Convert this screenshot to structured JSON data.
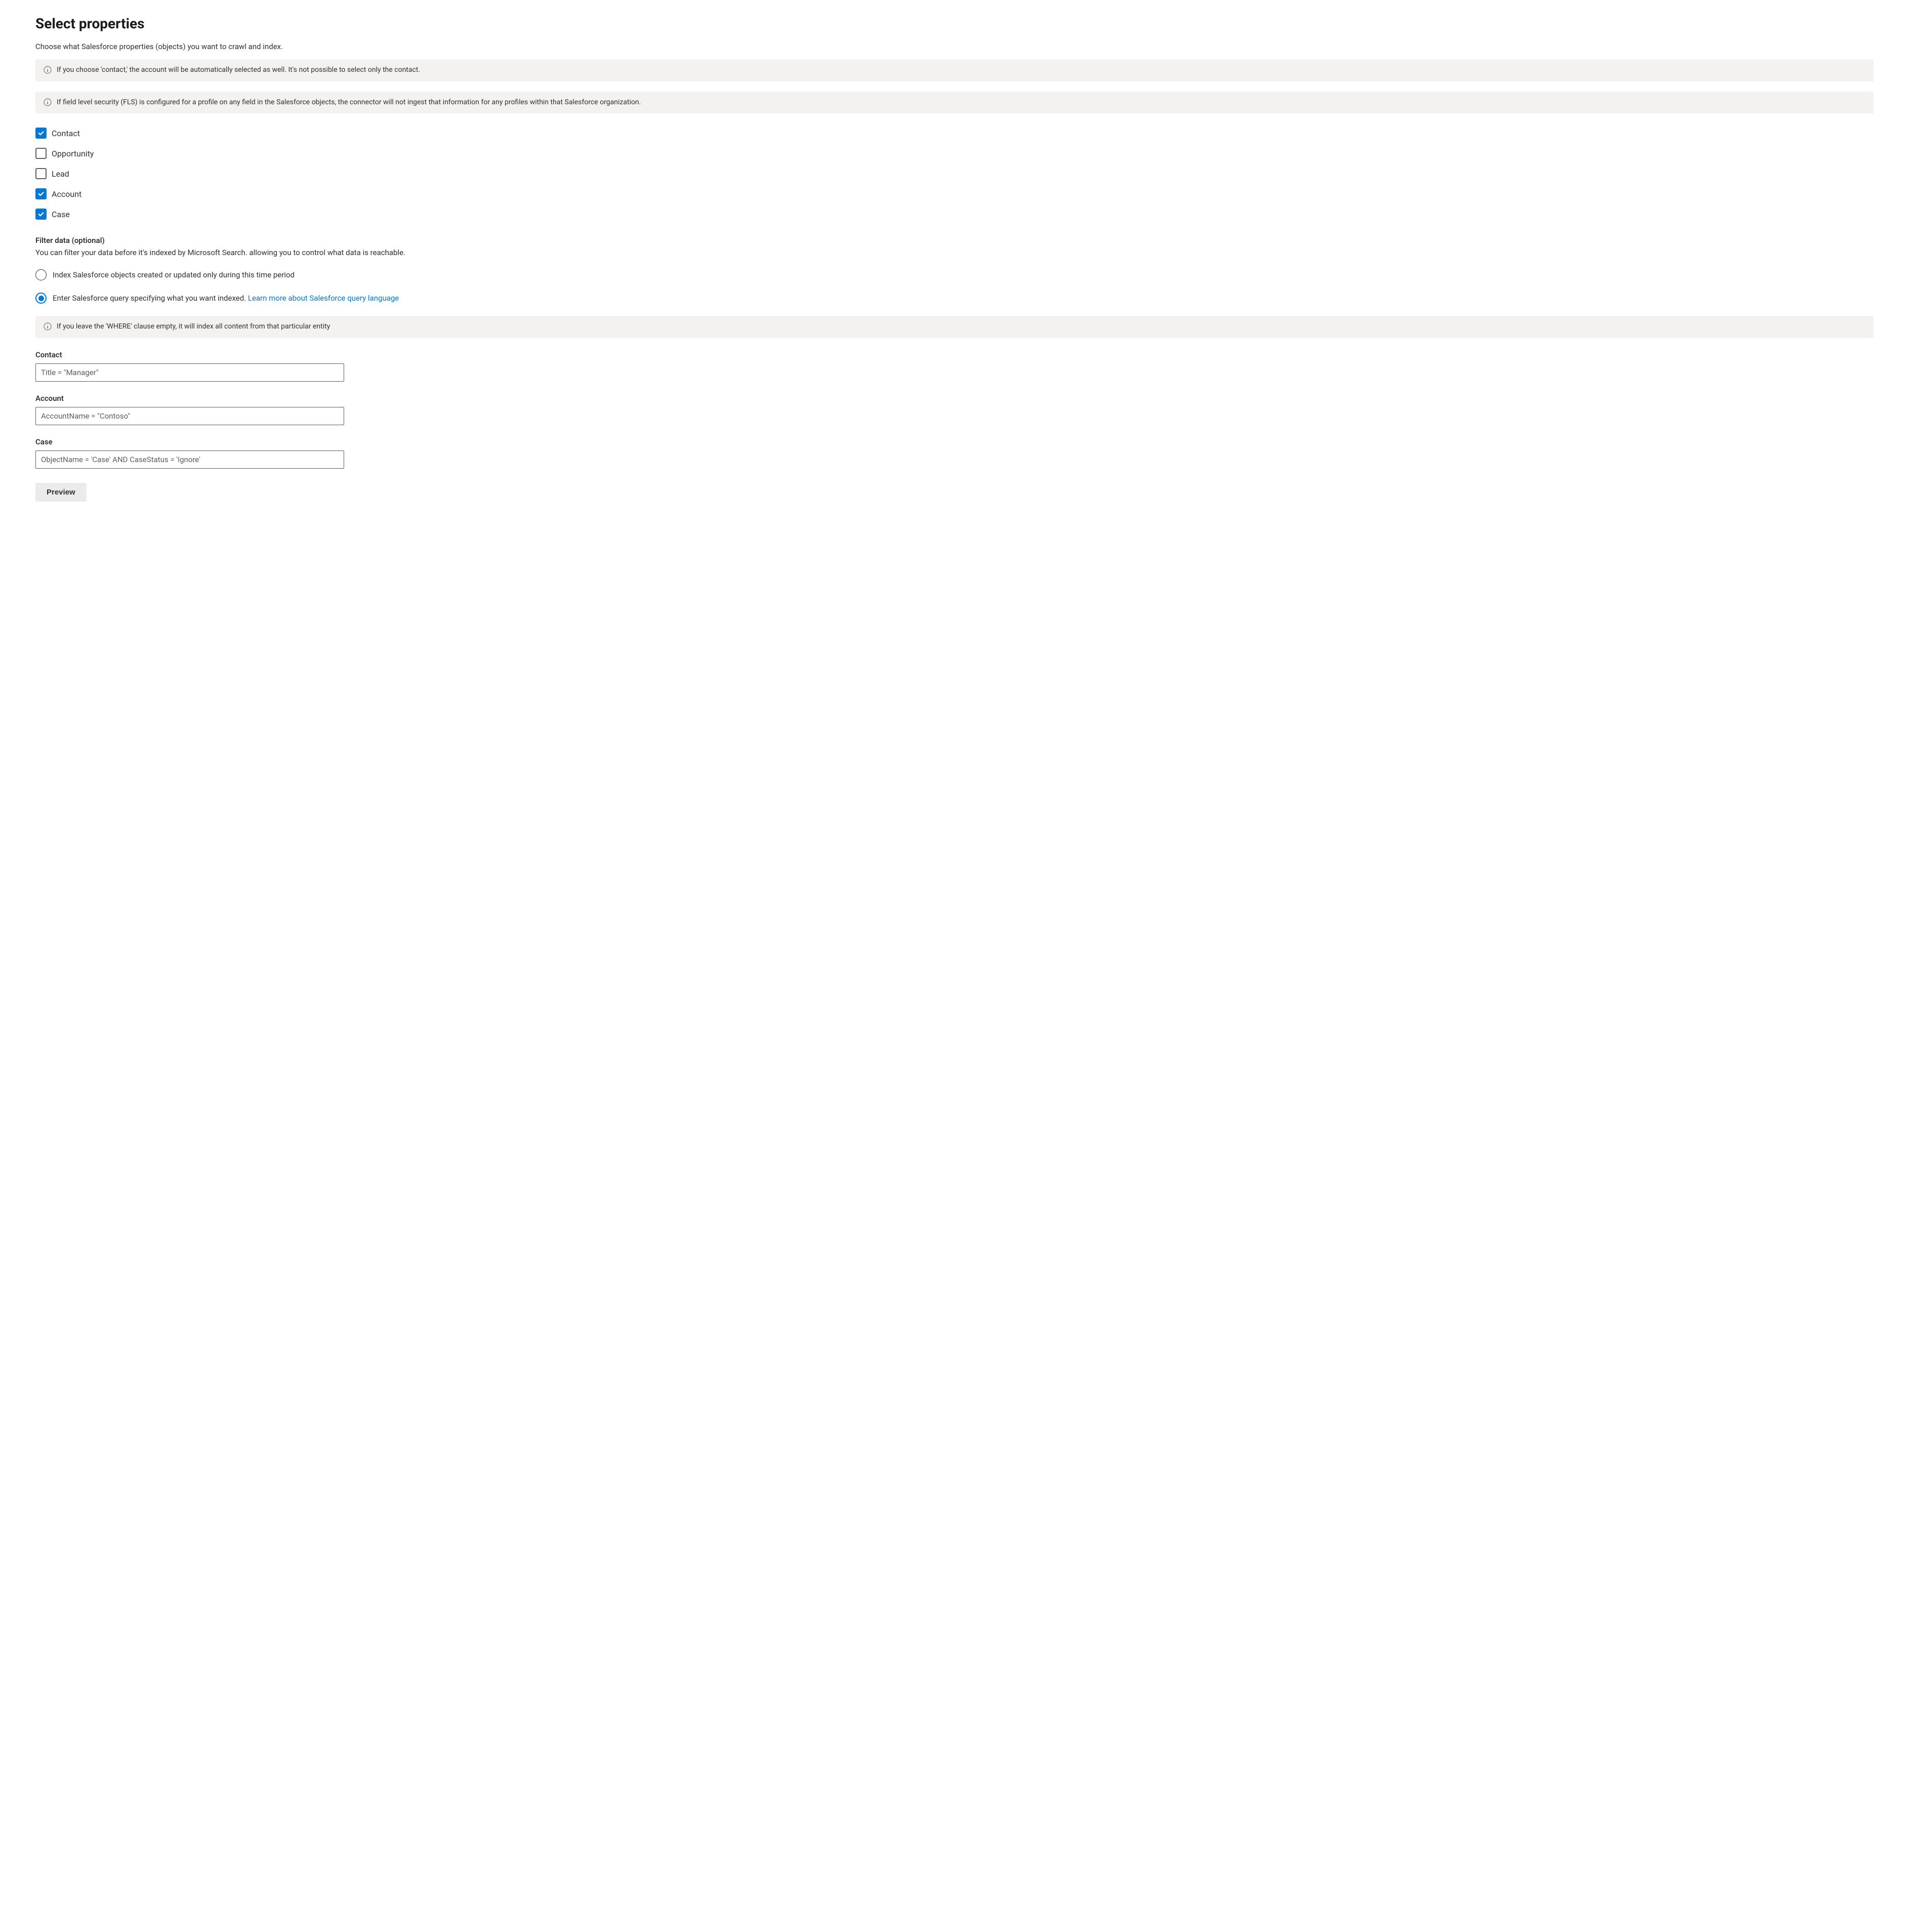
{
  "page": {
    "title": "Select properties",
    "subtitle": "Choose what Salesforce properties (objects) you want to crawl and index."
  },
  "banners": {
    "contact_note": "If you choose 'contact,' the account will be automatically selected as well. It's not possible to select only the contact.",
    "fls_note": "If field level security (FLS) is configured for a profile on any field in the Salesforce objects, the connector will not ingest that information for any profiles within that Salesforce organization.",
    "where_note": "If you leave the 'WHERE' clause empty, it will index all content from that particular entity"
  },
  "objects": [
    {
      "label": "Contact",
      "checked": true
    },
    {
      "label": "Opportunity",
      "checked": false
    },
    {
      "label": "Lead",
      "checked": false
    },
    {
      "label": "Account",
      "checked": true
    },
    {
      "label": "Case",
      "checked": true
    }
  ],
  "filter": {
    "heading": "Filter data (optional)",
    "description": "You can filter your data before it's indexed by Microsoft Search. allowing you to control what data is reachable.",
    "radios": {
      "time_period": "Index Salesforce objects created or updated only during this time period",
      "query": "Enter Salesforce query specifying what you want indexed.",
      "query_link": "Learn more about Salesforce query language"
    },
    "selected": "query"
  },
  "queries": [
    {
      "label": "Contact",
      "value": "Title = \"Manager\""
    },
    {
      "label": "Account",
      "value": "AccountName = \"Contoso\""
    },
    {
      "label": "Case",
      "value": "ObjectName = 'Case' AND CaseStatus = 'Ignore'"
    }
  ],
  "buttons": {
    "preview": "Preview"
  }
}
